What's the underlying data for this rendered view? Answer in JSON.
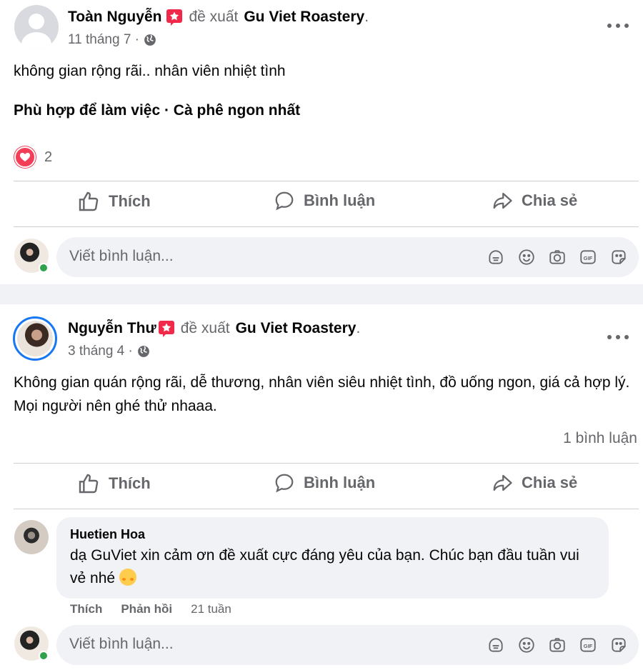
{
  "posts": [
    {
      "author": "Toàn Nguyễn",
      "suggest_text": "đề xuất",
      "page": "Gu Viet Roastery",
      "date": "11 tháng 7 ·",
      "text": "không gian rộng rãi.. nhân viên nhiệt tình",
      "tags": "Phù hợp để làm việc · Cà phê ngon nhất",
      "reaction_count": "2"
    },
    {
      "author": "Nguyễn Thư",
      "suggest_text": "đề xuất",
      "page": "Gu Viet Roastery",
      "date": "3 tháng 4 ·",
      "text": "Không gian quán rộng rãi, dễ thương, nhân viên siêu nhiệt tình, đồ uống ngon, giá cả hợp lý. Mọi người nên ghé thử nhaaa.",
      "comment_count": "1 bình luận"
    }
  ],
  "actions": {
    "like": "Thích",
    "comment": "Bình luận",
    "share": "Chia sẻ"
  },
  "comment_box": {
    "placeholder": "Viết bình luận..."
  },
  "comment": {
    "author": "Huetien Hoa",
    "text": "dạ GuViet xin cảm ơn đề xuất cực đáng yêu của bạn. Chúc bạn đầu tuần vui vẻ nhé",
    "emoji": "smiling-face-with-hearts",
    "like": "Thích",
    "reply": "Phản hồi",
    "time": "21 tuần"
  },
  "colors": {
    "accent": "#1877f2",
    "heart": "#f33e58",
    "secondary_text": "#65676b",
    "online": "#31a24c"
  },
  "icons": [
    "recommend-badge-icon",
    "globe-icon",
    "more-icon",
    "heart-reaction-icon",
    "like-icon",
    "comment-icon",
    "share-icon",
    "sticker-icon",
    "emoji-icon",
    "camera-icon",
    "gif-icon",
    "avatar-sticker-icon"
  ]
}
